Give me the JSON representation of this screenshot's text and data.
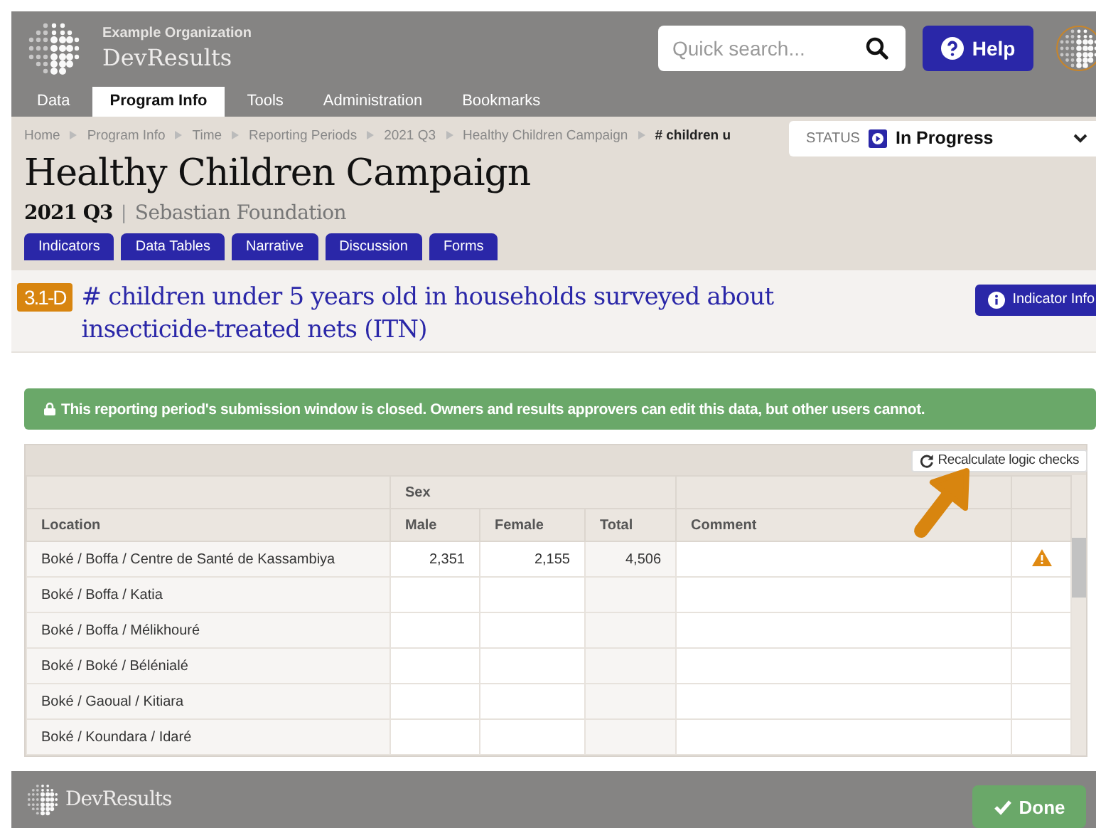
{
  "header": {
    "organization": "Example Organization",
    "app_name": "DevResults",
    "search": {
      "placeholder": "Quick search..."
    },
    "help_button": "Help"
  },
  "nav_tabs": [
    {
      "label": "Data",
      "selected": false
    },
    {
      "label": "Program Info",
      "selected": true
    },
    {
      "label": "Tools",
      "selected": false
    },
    {
      "label": "Administration",
      "selected": false
    },
    {
      "label": "Bookmarks",
      "selected": false
    }
  ],
  "breadcrumbs": [
    "Home",
    "Program Info",
    "Time",
    "Reporting Periods",
    "2021 Q3",
    "Healthy Children Campaign",
    "# children u"
  ],
  "status": {
    "label": "STATUS",
    "value": "In Progress"
  },
  "page_title": "Healthy Children Campaign",
  "period": "2021 Q3",
  "separator": "|",
  "organization": "Sebastian Foundation",
  "sub_tabs": [
    {
      "label": "Indicators",
      "selected": false
    },
    {
      "label": "Data Tables",
      "selected": false
    },
    {
      "label": "Narrative",
      "selected": false
    },
    {
      "label": "Discussion",
      "selected": false
    },
    {
      "label": "Forms",
      "selected": false
    }
  ],
  "indicator": {
    "code": "3.1-D",
    "title": "# children under 5 years old in households surveyed about insecticide-treated nets (ITN)",
    "info_button": "Indicator Info"
  },
  "alert": "This reporting period's submission window is closed. Owners and results approvers can edit this data, but other users cannot.",
  "recalculate_button": "Recalculate logic checks",
  "table": {
    "group_header": "Sex",
    "columns": [
      "Location",
      "Male",
      "Female",
      "Total",
      "Comment"
    ],
    "rows": [
      {
        "cells": [
          "Boké / Boffa / Centre de Santé de Kassambiya",
          "2,351",
          "2,155",
          "4,506",
          ""
        ],
        "warning": true
      },
      {
        "cells": [
          "Boké / Boffa / Katia",
          "",
          "",
          "",
          ""
        ],
        "warning": false
      },
      {
        "cells": [
          "Boké / Boffa / Mélikhouré",
          "",
          "",
          "",
          ""
        ],
        "warning": false
      },
      {
        "cells": [
          "Boké / Boké / Bélénialé",
          "",
          "",
          "",
          ""
        ],
        "warning": false
      },
      {
        "cells": [
          "Boké / Gaoual / Kitiara",
          "",
          "",
          "",
          ""
        ],
        "warning": false
      },
      {
        "cells": [
          "Boké / Koundara / Idaré",
          "",
          "",
          "",
          ""
        ],
        "warning": false
      }
    ]
  },
  "footer": {
    "brand": "DevResults",
    "done_button": "Done"
  }
}
